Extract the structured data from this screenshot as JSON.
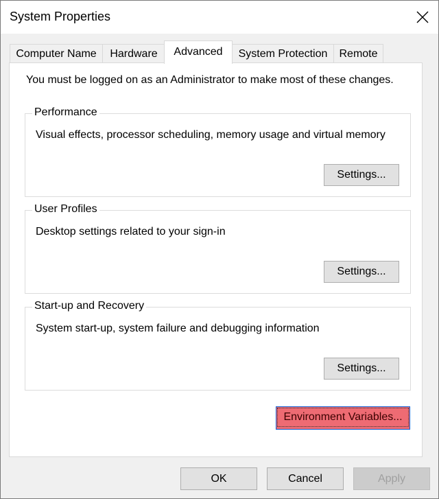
{
  "window": {
    "title": "System Properties"
  },
  "tabs": [
    {
      "label": "Computer Name"
    },
    {
      "label": "Hardware"
    },
    {
      "label": "Advanced"
    },
    {
      "label": "System Protection"
    },
    {
      "label": "Remote"
    }
  ],
  "active_tab": "Advanced",
  "panel": {
    "note": "You must be logged on as an Administrator to make most of these changes.",
    "groups": [
      {
        "title": "Performance",
        "description": "Visual effects, processor scheduling, memory usage and virtual memory",
        "button": "Settings..."
      },
      {
        "title": "User Profiles",
        "description": "Desktop settings related to your sign-in",
        "button": "Settings..."
      },
      {
        "title": "Start-up and Recovery",
        "description": "System start-up, system failure and debugging information",
        "button": "Settings..."
      }
    ],
    "env_button": "Environment Variables...",
    "env_button_color": "#ee6b73"
  },
  "footer": {
    "ok": "OK",
    "cancel": "Cancel",
    "apply": "Apply"
  },
  "icons": {
    "close": "close-icon"
  }
}
